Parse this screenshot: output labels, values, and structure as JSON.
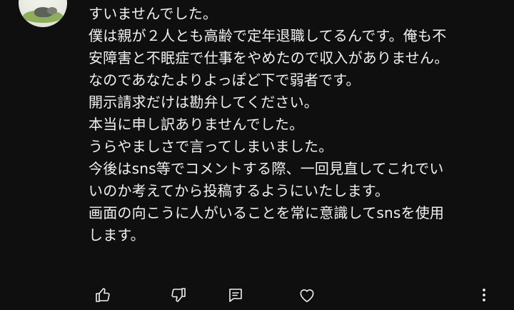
{
  "comment": {
    "lines": [
      "すいませんでした。",
      "僕は親が２人とも高齢で定年退職してるんです。俺も不",
      "安障害と不眠症で仕事をやめたので収入がありません。",
      "なのであなたよりよっぽど下で弱者です。",
      "開示請求だけは勘弁してください。",
      "本当に申し訳ありませんでした。",
      "うらやましさで言ってしまいました。",
      "今後はsns等でコメントする際、一回見直してこれでい",
      "いのか考えてから投稿するようにいたします。",
      "画面の向こうに人がいることを常に意識してsnsを使用",
      "します。"
    ]
  },
  "actions": {
    "like_icon": "thumbs-up-icon",
    "dislike_icon": "thumbs-down-icon",
    "reply_icon": "comment-icon",
    "heart_icon": "heart-icon",
    "more_icon": "more-vertical-icon"
  },
  "colors": {
    "background": "#0f0f0f",
    "text": "#f1f1f1"
  }
}
